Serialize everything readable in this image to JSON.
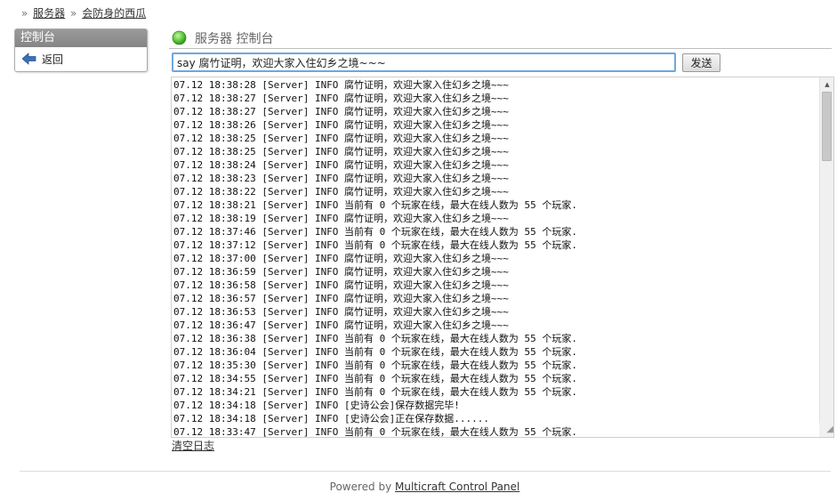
{
  "breadcrumb": {
    "separator": "»",
    "items": [
      "服务器",
      "会防身的西瓜"
    ]
  },
  "sidebar": {
    "title": "控制台",
    "back_label": "返回"
  },
  "header": {
    "title": "服务器 控制台",
    "status_color": "#5cc83a"
  },
  "command": {
    "value": "say 腐竹证明，欢迎大家入住幻乡之境~~~",
    "send_label": "发送"
  },
  "log_lines": [
    "07.12 18:38:28 [Server] INFO 腐竹证明，欢迎大家入住幻乡之境~~~",
    "07.12 18:38:27 [Server] INFO 腐竹证明，欢迎大家入住幻乡之境~~~",
    "07.12 18:38:27 [Server] INFO 腐竹证明，欢迎大家入住幻乡之境~~~",
    "07.12 18:38:26 [Server] INFO 腐竹证明，欢迎大家入住幻乡之境~~~",
    "07.12 18:38:25 [Server] INFO 腐竹证明，欢迎大家入住幻乡之境~~~",
    "07.12 18:38:25 [Server] INFO 腐竹证明，欢迎大家入住幻乡之境~~~",
    "07.12 18:38:24 [Server] INFO 腐竹证明，欢迎大家入住幻乡之境~~~",
    "07.12 18:38:23 [Server] INFO 腐竹证明，欢迎大家入住幻乡之境~~~",
    "07.12 18:38:22 [Server] INFO 腐竹证明，欢迎大家入住幻乡之境~~~",
    "07.12 18:38:21 [Server] INFO 当前有 0 个玩家在线，最大在线人数为 55 个玩家.",
    "07.12 18:38:19 [Server] INFO 腐竹证明，欢迎大家入住幻乡之境~~~",
    "07.12 18:37:46 [Server] INFO 当前有 0 个玩家在线，最大在线人数为 55 个玩家.",
    "07.12 18:37:12 [Server] INFO 当前有 0 个玩家在线，最大在线人数为 55 个玩家.",
    "07.12 18:37:00 [Server] INFO 腐竹证明，欢迎大家入住幻乡之境~~~",
    "07.12 18:36:59 [Server] INFO 腐竹证明，欢迎大家入住幻乡之境~~~",
    "07.12 18:36:58 [Server] INFO 腐竹证明，欢迎大家入住幻乡之境~~~",
    "07.12 18:36:57 [Server] INFO 腐竹证明，欢迎大家入住幻乡之境~~~",
    "07.12 18:36:53 [Server] INFO 腐竹证明，欢迎大家入住幻乡之境~~~",
    "07.12 18:36:47 [Server] INFO 腐竹证明，欢迎大家入住幻乡之境~~~",
    "07.12 18:36:38 [Server] INFO 当前有 0 个玩家在线，最大在线人数为 55 个玩家.",
    "07.12 18:36:04 [Server] INFO 当前有 0 个玩家在线，最大在线人数为 55 个玩家.",
    "07.12 18:35:30 [Server] INFO 当前有 0 个玩家在线，最大在线人数为 55 个玩家.",
    "07.12 18:34:55 [Server] INFO 当前有 0 个玩家在线，最大在线人数为 55 个玩家.",
    "07.12 18:34:21 [Server] INFO 当前有 0 个玩家在线，最大在线人数为 55 个玩家.",
    "07.12 18:34:18 [Server] INFO [史诗公会]保存数据完毕!",
    "07.12 18:34:18 [Server] INFO [史诗公会]正在保存数据......",
    "07.12 18:33:47 [Server] INFO 当前有 0 个玩家在线，最大在线人数为 55 个玩家."
  ],
  "clear_log_label": "清空日志",
  "footer": {
    "prefix": "Powered by ",
    "link": "Multicraft Control Panel"
  }
}
